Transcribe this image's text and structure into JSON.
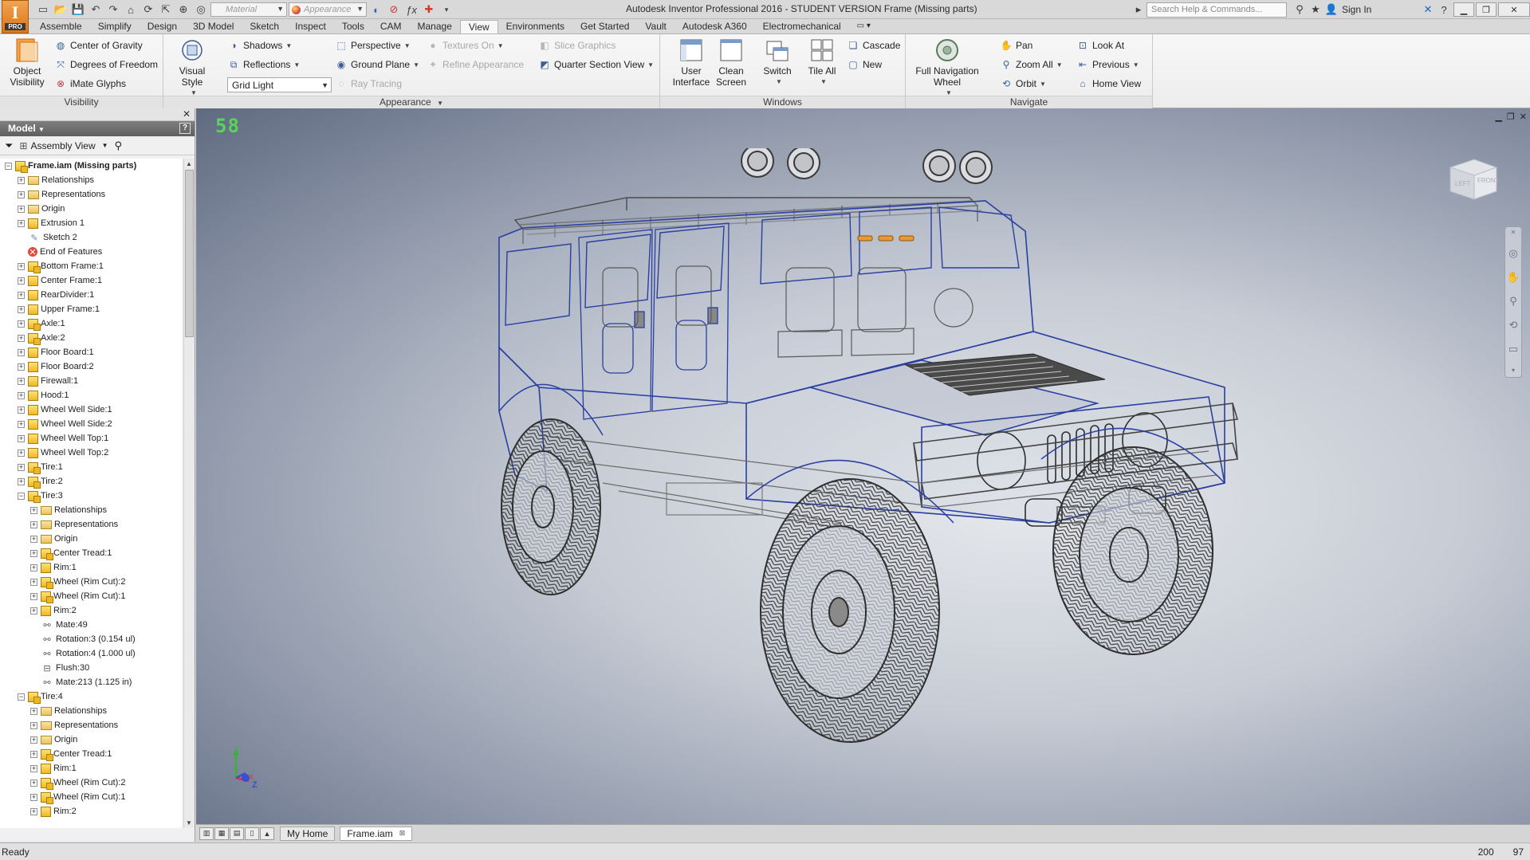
{
  "window": {
    "title": "Autodesk Inventor Professional 2016 - STUDENT VERSION   Frame (Missing parts)",
    "search_placeholder": "Search Help & Commands...",
    "sign_in": "Sign In"
  },
  "app_logo": {
    "letter": "I",
    "edition": "PRO"
  },
  "quick_access": {
    "material_placeholder": "Material",
    "appearance_placeholder": "Appearance"
  },
  "tabs": [
    "Assemble",
    "Simplify",
    "Design",
    "3D Model",
    "Sketch",
    "Inspect",
    "Tools",
    "CAM",
    "Manage",
    "View",
    "Environments",
    "Get Started",
    "Vault",
    "Autodesk A360",
    "Electromechanical"
  ],
  "active_tab": "View",
  "ribbon": {
    "visibility": {
      "label": "Visibility",
      "object_visibility": "Object Visibility",
      "center_of_gravity": "Center of Gravity",
      "degrees_of_freedom": "Degrees of Freedom",
      "imate_glyphs": "iMate Glyphs"
    },
    "appearance": {
      "label": "Appearance",
      "visual_style": "Visual Style",
      "shadows": "Shadows",
      "reflections": "Reflections",
      "lighting": "Grid Light",
      "perspective": "Perspective",
      "ground_plane": "Ground Plane",
      "ray_tracing": "Ray Tracing",
      "textures_on": "Textures On",
      "refine_appearance": "Refine Appearance",
      "slice_graphics": "Slice Graphics",
      "quarter_section_view": "Quarter Section View"
    },
    "windows": {
      "label": "Windows",
      "user_interface": "User Interface",
      "clean_screen": "Clean Screen",
      "switch": "Switch",
      "tile_all": "Tile All",
      "cascade": "Cascade",
      "new": "New"
    },
    "navigate": {
      "label": "Navigate",
      "full_navigation_wheel": "Full Navigation Wheel",
      "pan": "Pan",
      "zoom_all": "Zoom All",
      "orbit": "Orbit",
      "look_at": "Look At",
      "previous": "Previous",
      "home_view": "Home View"
    }
  },
  "browser": {
    "title": "Model",
    "view_mode": "Assembly View",
    "items": [
      {
        "label": "Frame.iam (Missing parts)",
        "icon": "assembly-icon",
        "exp": "-",
        "level": 0,
        "bold": true
      },
      {
        "label": "Relationships",
        "icon": "folder-icon",
        "exp": "+",
        "level": 1
      },
      {
        "label": "Representations",
        "icon": "representations-icon",
        "exp": "+",
        "level": 1
      },
      {
        "label": "Origin",
        "icon": "folder-icon",
        "exp": "+",
        "level": 1
      },
      {
        "label": "Extrusion 1",
        "icon": "part-icon",
        "exp": "+",
        "level": 1
      },
      {
        "label": "Sketch 2",
        "icon": "sketch-icon",
        "exp": "",
        "level": 1
      },
      {
        "label": "End of Features",
        "icon": "error-icon",
        "exp": "",
        "level": 1
      },
      {
        "label": "Bottom Frame:1",
        "icon": "assembly-icon",
        "exp": "+",
        "level": 1
      },
      {
        "label": "Center Frame:1",
        "icon": "part-icon",
        "exp": "+",
        "level": 1
      },
      {
        "label": "RearDivider:1",
        "icon": "part-icon",
        "exp": "+",
        "level": 1
      },
      {
        "label": "Upper Frame:1",
        "icon": "part-icon",
        "exp": "+",
        "level": 1
      },
      {
        "label": "Axle:1",
        "icon": "assembly-icon",
        "exp": "+",
        "level": 1
      },
      {
        "label": "Axle:2",
        "icon": "assembly-icon",
        "exp": "+",
        "level": 1
      },
      {
        "label": "Floor Board:1",
        "icon": "part-icon",
        "exp": "+",
        "level": 1
      },
      {
        "label": "Floor Board:2",
        "icon": "part-icon",
        "exp": "+",
        "level": 1
      },
      {
        "label": "Firewall:1",
        "icon": "part-icon",
        "exp": "+",
        "level": 1
      },
      {
        "label": "Hood:1",
        "icon": "part-icon",
        "exp": "+",
        "level": 1
      },
      {
        "label": "Wheel Well Side:1",
        "icon": "part-icon",
        "exp": "+",
        "level": 1
      },
      {
        "label": "Wheel Well Side:2",
        "icon": "part-icon",
        "exp": "+",
        "level": 1
      },
      {
        "label": "Wheel Well Top:1",
        "icon": "part-icon",
        "exp": "+",
        "level": 1
      },
      {
        "label": "Wheel Well Top:2",
        "icon": "part-icon",
        "exp": "+",
        "level": 1
      },
      {
        "label": "Tire:1",
        "icon": "assembly-icon",
        "exp": "+",
        "level": 1
      },
      {
        "label": "Tire:2",
        "icon": "assembly-icon",
        "exp": "+",
        "level": 1
      },
      {
        "label": "Tire:3",
        "icon": "assembly-icon",
        "exp": "-",
        "level": 1
      },
      {
        "label": "Relationships",
        "icon": "folder-icon",
        "exp": "+",
        "level": 2
      },
      {
        "label": "Representations",
        "icon": "representations-icon",
        "exp": "+",
        "level": 2
      },
      {
        "label": "Origin",
        "icon": "folder-icon",
        "exp": "+",
        "level": 2
      },
      {
        "label": "Center Tread:1",
        "icon": "assembly-icon",
        "exp": "+",
        "level": 2
      },
      {
        "label": "Rim:1",
        "icon": "part-icon",
        "exp": "+",
        "level": 2
      },
      {
        "label": "Wheel (Rim Cut):2",
        "icon": "assembly-icon",
        "exp": "+",
        "level": 2
      },
      {
        "label": "Wheel (Rim Cut):1",
        "icon": "assembly-icon",
        "exp": "+",
        "level": 2
      },
      {
        "label": "Rim:2",
        "icon": "part-icon",
        "exp": "+",
        "level": 2
      },
      {
        "label": "Mate:49",
        "icon": "constraint-icon",
        "exp": "",
        "level": 2
      },
      {
        "label": "Rotation:3 (0.154 ul)",
        "icon": "constraint-icon",
        "exp": "",
        "level": 2
      },
      {
        "label": "Rotation:4 (1.000 ul)",
        "icon": "constraint-icon",
        "exp": "",
        "level": 2
      },
      {
        "label": "Flush:30",
        "icon": "flush-icon",
        "exp": "",
        "level": 2
      },
      {
        "label": "Mate:213 (1.125 in)",
        "icon": "constraint-icon",
        "exp": "",
        "level": 2
      },
      {
        "label": "Tire:4",
        "icon": "assembly-icon",
        "exp": "-",
        "level": 1
      },
      {
        "label": "Relationships",
        "icon": "folder-icon",
        "exp": "+",
        "level": 2
      },
      {
        "label": "Representations",
        "icon": "representations-icon",
        "exp": "+",
        "level": 2
      },
      {
        "label": "Origin",
        "icon": "folder-icon",
        "exp": "+",
        "level": 2
      },
      {
        "label": "Center Tread:1",
        "icon": "assembly-icon",
        "exp": "+",
        "level": 2
      },
      {
        "label": "Rim:1",
        "icon": "part-icon",
        "exp": "+",
        "level": 2
      },
      {
        "label": "Wheel (Rim Cut):2",
        "icon": "assembly-icon",
        "exp": "+",
        "level": 2
      },
      {
        "label": "Wheel (Rim Cut):1",
        "icon": "assembly-icon",
        "exp": "+",
        "level": 2
      },
      {
        "label": "Rim:2",
        "icon": "part-icon",
        "exp": "+",
        "level": 2
      }
    ]
  },
  "viewport": {
    "fps": "58",
    "viewcube_left": "LEFT",
    "viewcube_front": "FRONT",
    "axis_y": "Y",
    "axis_x": "X",
    "axis_z": "Z"
  },
  "doc_tabs": {
    "home": "My Home",
    "file": "Frame.iam"
  },
  "status": {
    "text": "Ready",
    "num1": "200",
    "num2": "97"
  },
  "colors": {
    "accent": "#3a5f94",
    "wire_blue": "#2a3fa0",
    "wire_gray": "#4a4a4a",
    "fps_green": "#5bd25b"
  }
}
